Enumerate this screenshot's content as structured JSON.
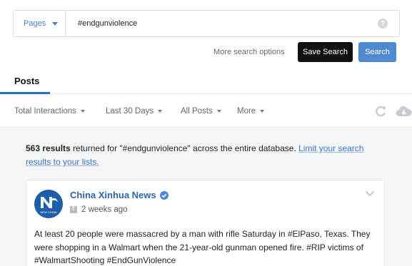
{
  "search": {
    "scope": "Pages",
    "query": "#endgunviolence",
    "help_icon": "?"
  },
  "actions": {
    "more_options": "More search options",
    "save_search": "Save Search",
    "search": "Search"
  },
  "tabs": {
    "posts": "Posts"
  },
  "filters": {
    "sort": "Total Interactions",
    "range": "Last 30 Days",
    "type": "All Posts",
    "more": "More"
  },
  "results": {
    "count": "563 results",
    "text": " returned for \"#endgunviolence\" across the entire database. ",
    "link": "Limit your search results to your lists."
  },
  "post": {
    "author": "China Xinhua News",
    "time": "2 weeks ago",
    "avatar_text": "NEW CHINA",
    "text": "At least 20 people were massacred by a man with rifle Saturday in #ElPaso, Texas. They were shopping in a Walmart when the 21-year-old gunman opened fire. #RIP victims of #WalmartShooting #EndGunViolence"
  },
  "colors": {
    "accent": "#4f8ad0",
    "link": "#3c74bf",
    "save_button": "#111111"
  }
}
